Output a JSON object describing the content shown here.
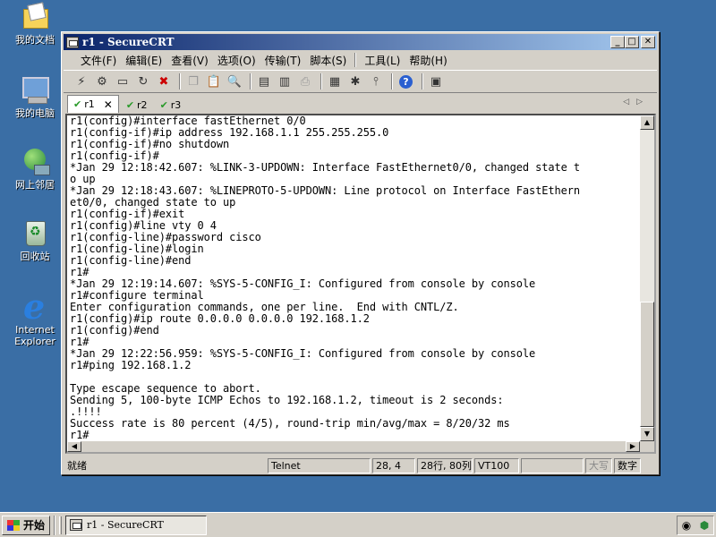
{
  "desktop": {
    "icons": [
      {
        "label": "我的文档",
        "icon": "my-documents-icon"
      },
      {
        "label": "我的电脑",
        "icon": "my-computer-icon"
      },
      {
        "label": "网上邻居",
        "icon": "network-places-icon"
      },
      {
        "label": "回收站",
        "icon": "recycle-bin-icon"
      },
      {
        "label": "Internet Explorer",
        "icon": "internet-explorer-icon"
      }
    ]
  },
  "window": {
    "title": "r1 - SecureCRT",
    "title_buttons": {
      "minimize": "_",
      "maximize": "□",
      "close": "✕"
    }
  },
  "menu": [
    "文件(F)",
    "编辑(E)",
    "查看(V)",
    "选项(O)",
    "传输(T)",
    "脚本(S)",
    "工具(L)",
    "帮助(H)"
  ],
  "toolbar": {
    "icons": [
      "connect-icon",
      "quick-connect-icon",
      "connect-tab-icon",
      "reconnect-icon",
      "disconnect-icon",
      "copy-icon",
      "paste-icon",
      "find-icon",
      "print-icon",
      "print-screen-icon",
      "print-setup-icon",
      "session-options-icon",
      "global-options-icon",
      "keymap-icon",
      "help-icon",
      "about-icon"
    ]
  },
  "tabs": [
    {
      "label": "r1",
      "active": true
    },
    {
      "label": "r2",
      "active": false
    },
    {
      "label": "r3",
      "active": false
    }
  ],
  "terminal": {
    "lines": [
      "r1(config)#interface fastEthernet 0/0",
      "r1(config-if)#ip address 192.168.1.1 255.255.255.0",
      "r1(config-if)#no shutdown",
      "r1(config-if)#",
      "*Jan 29 12:18:42.607: %LINK-3-UPDOWN: Interface FastEthernet0/0, changed state t",
      "o up",
      "*Jan 29 12:18:43.607: %LINEPROTO-5-UPDOWN: Line protocol on Interface FastEthern",
      "et0/0, changed state to up",
      "r1(config-if)#exit",
      "r1(config)#line vty 0 4",
      "r1(config-line)#password cisco",
      "r1(config-line)#login",
      "r1(config-line)#end",
      "r1#",
      "*Jan 29 12:19:14.607: %SYS-5-CONFIG_I: Configured from console by console",
      "r1#configure terminal",
      "Enter configuration commands, one per line.  End with CNTL/Z.",
      "r1(config)#ip route 0.0.0.0 0.0.0.0 192.168.1.2",
      "r1(config)#end",
      "r1#",
      "*Jan 29 12:22:56.959: %SYS-5-CONFIG_I: Configured from console by console",
      "r1#ping 192.168.1.2",
      "",
      "Type escape sequence to abort.",
      "Sending 5, 100-byte ICMP Echos to 192.168.1.2, timeout is 2 seconds:",
      ".!!!!",
      "Success rate is 80 percent (4/5), round-trip min/avg/max = 8/20/32 ms",
      "r1#"
    ]
  },
  "status": {
    "ready": "就绪",
    "protocol": "Telnet",
    "cursor": "28,  4",
    "size": "28行, 80列",
    "emulation": "VT100",
    "caps": "大写",
    "num": "数字"
  },
  "taskbar": {
    "start_label": "开始",
    "task_label": "r1 - SecureCRT"
  }
}
